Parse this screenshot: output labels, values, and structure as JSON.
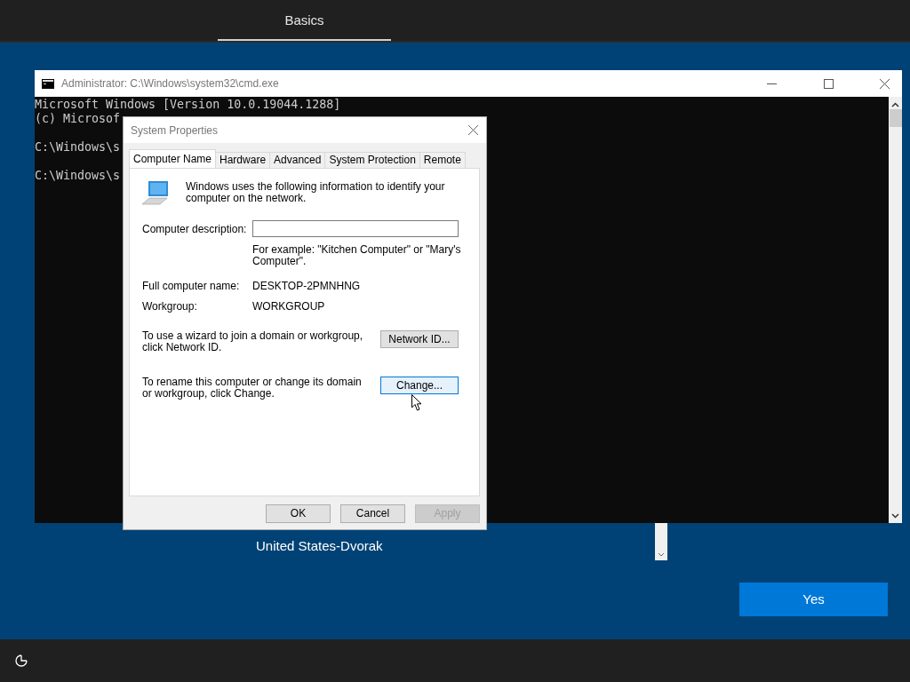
{
  "top_bar": {
    "tabs": [
      {
        "label": "Basics",
        "selected": true
      }
    ]
  },
  "console_window": {
    "title": "Administrator: C:\\Windows\\system32\\cmd.exe",
    "paragraphs": [
      {
        "lines": [
          "Microsoft Windows [Version 10.0.19044.1288]",
          "(c) Microsof"
        ]
      },
      {
        "lines": [
          "C:\\Windows\\s"
        ]
      },
      {
        "lines": [
          "C:\\Windows\\s"
        ]
      }
    ]
  },
  "dialog": {
    "title": "System Properties",
    "tabs": [
      {
        "label": "Computer Name",
        "selected": true
      },
      {
        "label": "Hardware",
        "selected": false
      },
      {
        "label": "Advanced",
        "selected": false
      },
      {
        "label": "System Protection",
        "selected": false
      },
      {
        "label": "Remote",
        "selected": false
      }
    ],
    "intro": "Windows uses the following information to identify your computer on the network.",
    "description_label": "Computer description:",
    "example": "For example: \"Kitchen Computer\" or \"Mary's Computer\".",
    "full_name_label": "Full computer name:",
    "full_name": "DESKTOP-2PMNHNG",
    "workgroup_label": "Workgroup:",
    "workgroup": "WORKGROUP",
    "network_text": "To use a wizard to join a domain or workgroup, click Network ID.",
    "network_button": {
      "label": "Network ID...",
      "focused": false
    },
    "rename_text": "To rename this computer or change its domain or workgroup, click Change.",
    "change_button": {
      "label": "Change...",
      "focused": true
    },
    "buttons": [
      {
        "label": "OK",
        "disabled": false
      },
      {
        "label": "Cancel",
        "disabled": false
      },
      {
        "label": "Apply",
        "disabled": true
      }
    ]
  },
  "keyboard_layout": "United States-Dvorak",
  "yes_button": "Yes"
}
